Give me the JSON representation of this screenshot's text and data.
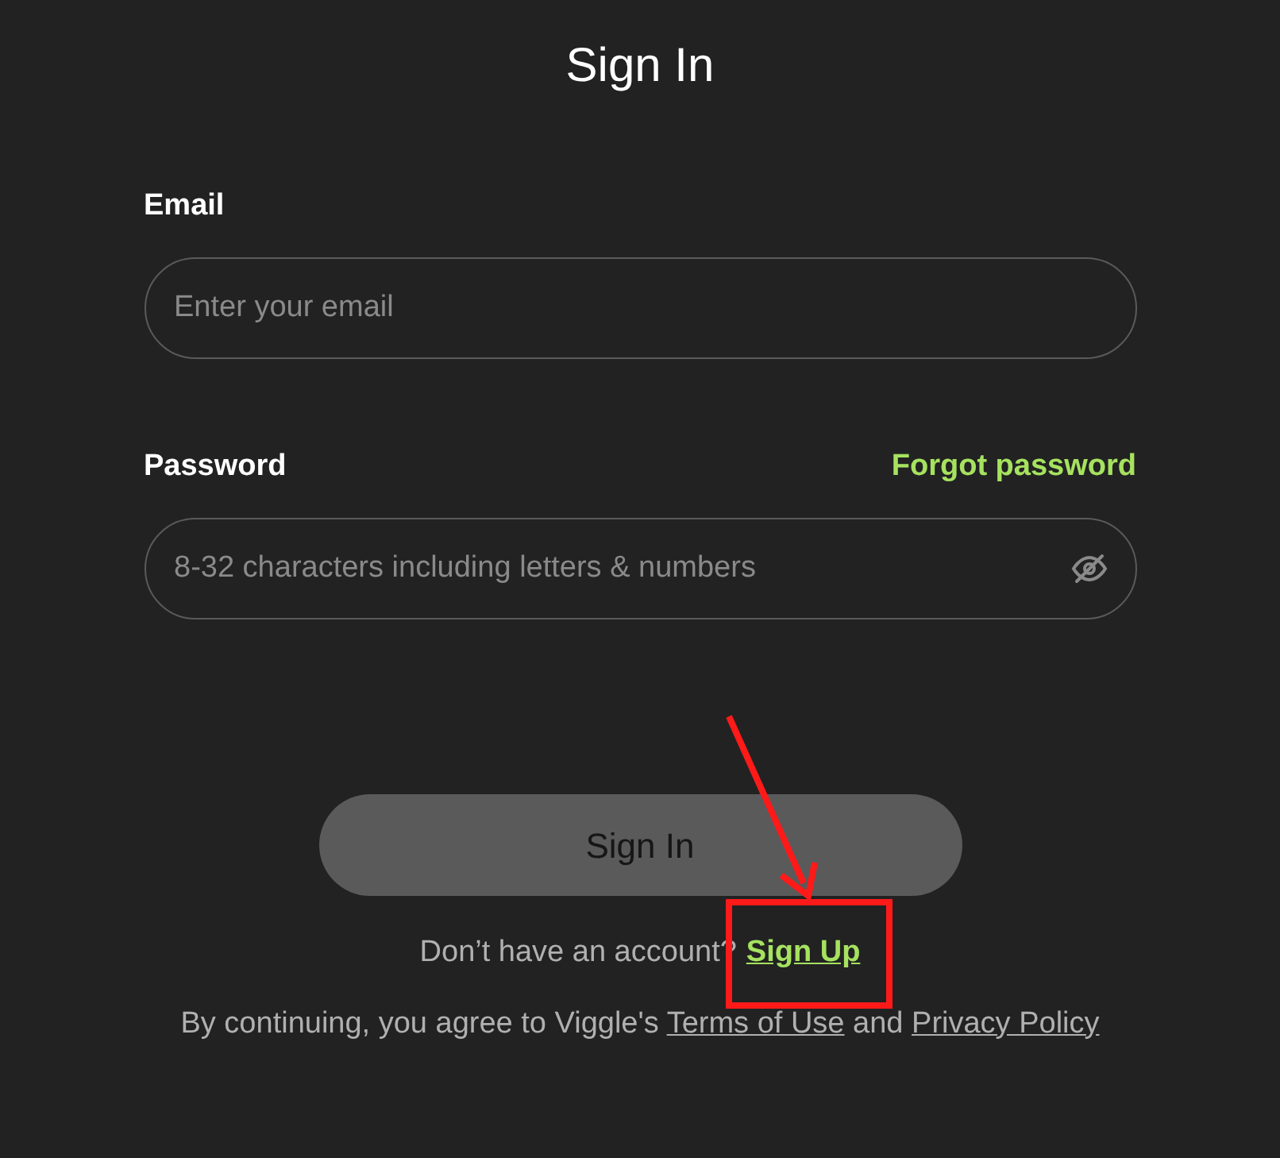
{
  "title": "Sign In",
  "fields": [
    {
      "label": "Email",
      "placeholder": "Enter your email",
      "kind": "text"
    },
    {
      "label": "Password",
      "placeholder": "8-32 characters including letters & numbers",
      "kind": "password",
      "link": "Forgot password"
    }
  ],
  "button": {
    "label": "Sign In",
    "disabled": true
  },
  "signup": {
    "prompt": "Don’t have an account?",
    "link": "Sign Up"
  },
  "legal": {
    "text": "By continuing, you agree to Viggle's",
    "terms": "Terms of Use",
    "joiner": "and",
    "privacy": "Privacy Policy"
  }
}
